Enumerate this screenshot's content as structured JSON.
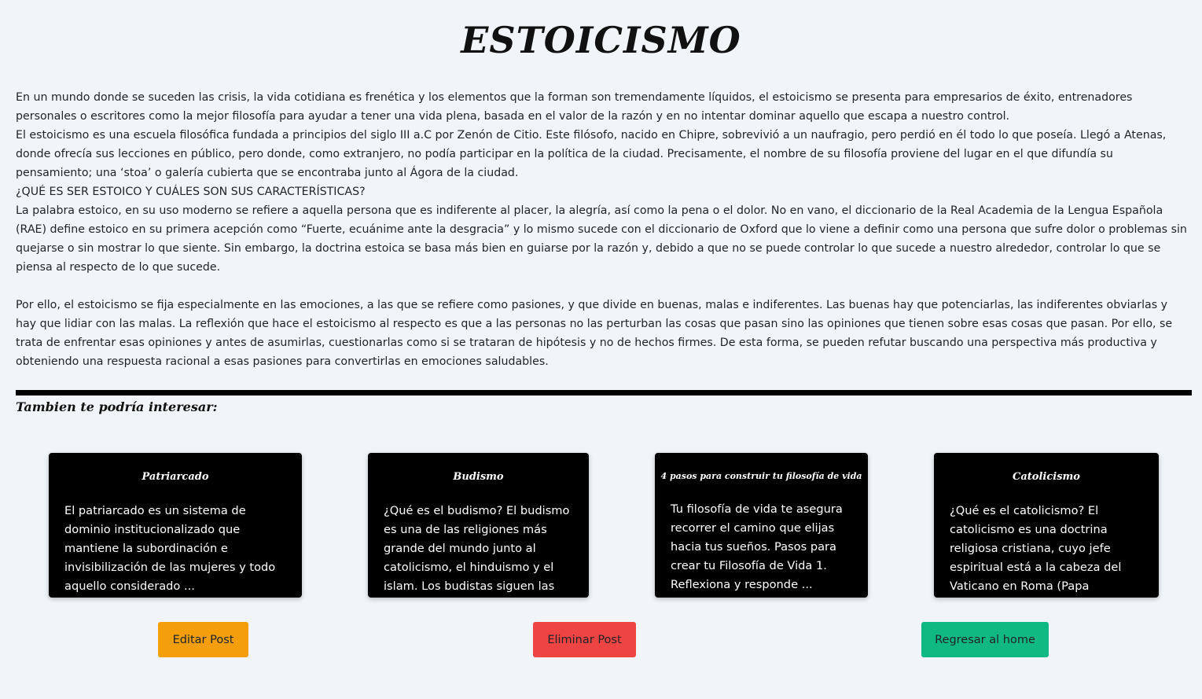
{
  "page": {
    "title": "ESTOICISMO"
  },
  "article": {
    "paragraphs": [
      "En un mundo donde se suceden las crisis, la vida cotidiana es frenética y los elementos que la forman son tremendamente líquidos, el estoicismo se presenta para empresarios de éxito, entrenadores personales o escritores como la mejor filosofía para ayudar a tener una vida plena, basada en el valor de la razón y en no intentar dominar aquello que escapa a nuestro control.",
      "El estoicismo es una escuela filosófica fundada a principios del siglo III a.C por Zenón de Citio. Este filósofo, nacido en Chipre, sobrevivió a un naufragio, pero perdió en él todo lo que poseía. Llegó a Atenas, donde ofrecía sus lecciones en público, pero donde, como extranjero, no podía participar en la política de la ciudad. Precisamente, el nombre de su filosofía proviene del lugar en el que difundía su pensamiento; una ‘stoa’ o galería cubierta que se encontraba junto al Ágora de la ciudad.",
      "¿QUÉ ES SER ESTOICO Y CUÁLES SON SUS CARACTERÍSTICAS?",
      "La palabra estoico, en su uso moderno se refiere a aquella persona que es indiferente al placer, la alegría, así como la pena o el dolor. No en vano, el diccionario de la Real Academia de la Lengua Española (RAE) define estoico en su primera acepción como “Fuerte, ecuánime ante la desgracia” y lo mismo sucede con el diccionario de Oxford que lo viene a definir como una persona que sufre dolor o problemas sin quejarse o sin mostrar lo que siente. Sin embargo, la doctrina estoica se basa más bien en guiarse por la razón y, debido a que no se puede controlar lo que sucede a nuestro alrededor, controlar lo que se piensa al respecto de lo que sucede.",
      "Por ello, el estoicismo se fija especialmente en las emociones, a las que se refiere como pasiones, y que divide en buenas, malas e indiferentes. Las buenas hay que potenciarlas, las indiferentes obviarlas y hay que lidiar con las malas. La reflexión que hace el estoicismo al respecto es que a las personas no las perturban las cosas que pasan sino las opiniones que tienen sobre esas cosas que pasan. Por ello, se trata de enfrentar esas opiniones y antes de asumirlas, cuestionarlas como si se trataran de hipótesis y no de hechos firmes. De esta forma, se pueden refutar buscando una perspectiva más productiva y obteniendo una respuesta racional a esas pasiones para convertirlas en emociones saludables."
    ]
  },
  "related": {
    "heading": "Tambien te podría interesar:",
    "cards": [
      {
        "title": "Patriarcado",
        "text": "El patriarcado es un sistema de dominio institucionalizado que mantiene la subordinación e invisibilización de las mujeres y todo aquello considerado ..."
      },
      {
        "title": "Budismo",
        "text": "¿Qué es el budismo? El budismo es una de las religiones más grande del mundo junto al catolicismo, el hinduismo y el islam. Los budistas siguen las e..."
      },
      {
        "title": "4 pasos para construir tu filosofía de vida",
        "text": "Tu filosofía de vida te asegura recorrer el camino que elijas hacia tus sueños. Pasos para crear tu Filosofía de Vida 1. Reflexiona y responde ..."
      },
      {
        "title": "Catolicismo",
        "text": "¿Qué es el catolicismo? El catolicismo es una doctrina religiosa cristiana, cuyo jefe espiritual está a la cabeza del Vaticano en Roma (Papa Francisc..."
      }
    ]
  },
  "actions": {
    "edit_label": "Editar Post",
    "delete_label": "Eliminar Post",
    "home_label": "Regresar al home"
  },
  "colors": {
    "background": "#f1f5f9",
    "card": "#000000",
    "edit_button": "#f59e0b",
    "delete_button": "#ef4444",
    "home_button": "#10b981"
  }
}
